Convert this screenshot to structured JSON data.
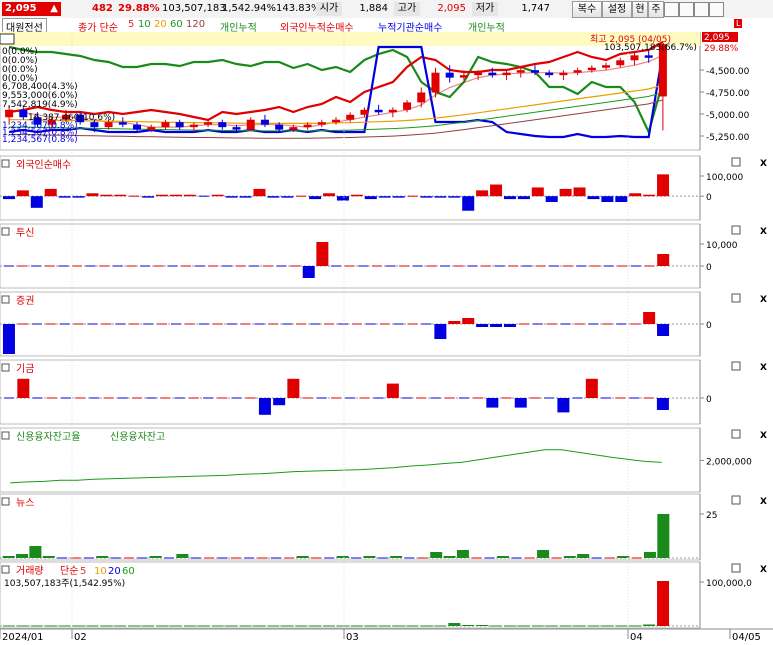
{
  "header": {
    "price": "2,095",
    "change": "482",
    "change_pct": "29.88%",
    "volume": "103,507,183",
    "volume_ratio": "1,542.94%",
    "turnover": "143.83%",
    "open_label": "시가",
    "open_value": "1,884",
    "high_label": "고가",
    "high_value": "2,095",
    "low_label": "저가",
    "low_value": "1,747",
    "buttons": [
      "복수",
      "설정",
      "현",
      "주"
    ]
  },
  "legend": {
    "stock_name": "대원전선",
    "close_label": "종가 단순",
    "ma_periods": [
      "5",
      "10",
      "20",
      "60",
      "120"
    ],
    "items": [
      "개인누적",
      "외국인누적순매수",
      "누적기관순매수",
      "개인누적"
    ]
  },
  "colors": {
    "up": "#e00000",
    "down": "#0000e0",
    "ma5": "#e03030",
    "ma10": "#1a9a1a",
    "ma20": "#e8a000",
    "ma60": "#1a9a1a",
    "ma120": "#904040",
    "individual": "#1a8a1a",
    "foreign": "#e00000",
    "institution": "#0000e0",
    "highlight": "#fffbc0"
  },
  "main_chart": {
    "max_label": "최고 2,095 (04/05)",
    "vol_callout": "103,507,183(66.7%)",
    "price_tag": "2,095",
    "pct_tag": "29.88%",
    "y_ticks": [
      "-4,500.00",
      "-4,750.00",
      "-5,000.00",
      "-5,250.00"
    ],
    "left_labels": [
      "0(0.0%)",
      "0(0.0%)",
      "0(0.0%)",
      "0(0.0%)",
      "6,708,400(4.3%)",
      "9,553,000(6.0%)",
      "7,542,819(4.9%)",
      "16,387,460(10.6%)",
      "1,234,567(0.8%)",
      "1,234,567(0.8%)",
      "1,234,567(0.8%)"
    ]
  },
  "panels": [
    {
      "title": "외국인순매수",
      "ticks": [
        "100,000",
        "0"
      ]
    },
    {
      "title": "투신",
      "ticks": [
        "10,000",
        "0"
      ]
    },
    {
      "title": "증권",
      "ticks": [
        "0"
      ]
    },
    {
      "title": "기금",
      "ticks": [
        "0"
      ]
    },
    {
      "title": "신용융자잔고율",
      "title2": "신용융자잔고",
      "ticks": [
        "2,000,000"
      ]
    },
    {
      "title": "뉴스",
      "ticks": [
        "25"
      ]
    },
    {
      "title": "거래량",
      "ma_label": "단순",
      "ma_periods": [
        "5",
        "10",
        "20",
        "60"
      ],
      "callout": "103,507,183주(1,542.95%)",
      "ticks": [
        "100,000,0"
      ]
    }
  ],
  "x_axis": {
    "labels": [
      "2024/01",
      "02",
      "03",
      "04",
      "04/05"
    ]
  },
  "chart_data": [
    {
      "type": "candlestick",
      "name": "main",
      "candles": [
        [
          1800,
          1850,
          1770,
          1830
        ],
        [
          1830,
          1840,
          1790,
          1800
        ],
        [
          1800,
          1820,
          1760,
          1770
        ],
        [
          1770,
          1800,
          1750,
          1790
        ],
        [
          1790,
          1830,
          1780,
          1810
        ],
        [
          1810,
          1820,
          1770,
          1780
        ],
        [
          1780,
          1790,
          1740,
          1760
        ],
        [
          1760,
          1790,
          1750,
          1780
        ],
        [
          1780,
          1800,
          1760,
          1770
        ],
        [
          1770,
          1780,
          1740,
          1750
        ],
        [
          1750,
          1770,
          1740,
          1760
        ],
        [
          1760,
          1790,
          1750,
          1780
        ],
        [
          1780,
          1790,
          1750,
          1760
        ],
        [
          1760,
          1780,
          1740,
          1770
        ],
        [
          1770,
          1790,
          1760,
          1780
        ],
        [
          1780,
          1790,
          1750,
          1760
        ],
        [
          1760,
          1770,
          1740,
          1750
        ],
        [
          1750,
          1800,
          1745,
          1790
        ],
        [
          1790,
          1810,
          1760,
          1770
        ],
        [
          1770,
          1780,
          1740,
          1750
        ],
        [
          1750,
          1770,
          1740,
          1760
        ],
        [
          1760,
          1780,
          1750,
          1770
        ],
        [
          1770,
          1790,
          1760,
          1780
        ],
        [
          1780,
          1800,
          1770,
          1790
        ],
        [
          1790,
          1820,
          1780,
          1810
        ],
        [
          1810,
          1840,
          1800,
          1830
        ],
        [
          1830,
          1850,
          1810,
          1820
        ],
        [
          1820,
          1840,
          1800,
          1830
        ],
        [
          1830,
          1870,
          1820,
          1860
        ],
        [
          1860,
          1920,
          1840,
          1900
        ],
        [
          1900,
          2000,
          1880,
          1980
        ],
        [
          1980,
          2010,
          1940,
          1960
        ],
        [
          1960,
          1990,
          1950,
          1970
        ],
        [
          1970,
          1990,
          1950,
          1980
        ],
        [
          1980,
          2000,
          1960,
          1970
        ],
        [
          1970,
          1990,
          1950,
          1980
        ],
        [
          1980,
          2000,
          1960,
          1990
        ],
        [
          1990,
          2010,
          1970,
          1980
        ],
        [
          1980,
          1990,
          1960,
          1970
        ],
        [
          1970,
          1990,
          1950,
          1980
        ],
        [
          1980,
          2000,
          1970,
          1990
        ],
        [
          1990,
          2010,
          1980,
          2000
        ],
        [
          2000,
          2020,
          1990,
          2010
        ],
        [
          2010,
          2040,
          2000,
          2030
        ],
        [
          2030,
          2060,
          2010,
          2050
        ],
        [
          2050,
          2070,
          2020,
          2040
        ],
        [
          1884,
          2095,
          1747,
          2095
        ]
      ],
      "ma5": [
        1830,
        1820,
        1810,
        1800,
        1800,
        1800,
        1790,
        1780,
        1780,
        1770,
        1760,
        1760,
        1760,
        1765,
        1770,
        1770,
        1765,
        1770,
        1770,
        1770,
        1765,
        1760,
        1770,
        1780,
        1790,
        1800,
        1810,
        1820,
        1830,
        1850,
        1890,
        1920,
        1940,
        1960,
        1970,
        1975,
        1978,
        1980,
        1980,
        1978,
        1980,
        1985,
        1990,
        2000,
        2010,
        2025,
        2050
      ],
      "ma20": [
        1790,
        1790,
        1789,
        1788,
        1787,
        1786,
        1785,
        1784,
        1783,
        1782,
        1781,
        1780,
        1779,
        1778,
        1778,
        1777,
        1776,
        1776,
        1775,
        1775,
        1775,
        1775,
        1776,
        1777,
        1778,
        1780,
        1782,
        1784,
        1787,
        1791,
        1796,
        1803,
        1810,
        1818,
        1826,
        1834,
        1842,
        1850,
        1858,
        1866,
        1874,
        1882,
        1890,
        1898,
        1906,
        1914,
        1930
      ],
      "individual": [
        0.95,
        0.92,
        0.9,
        0.9,
        0.88,
        0.86,
        0.82,
        0.8,
        0.75,
        0.75,
        0.78,
        0.78,
        0.76,
        0.8,
        0.8,
        0.82,
        0.78,
        0.76,
        0.8,
        0.8,
        0.74,
        0.78,
        0.72,
        0.75,
        0.7,
        0.82,
        0.88,
        0.92,
        0.85,
        0.6,
        0.5,
        0.45,
        0.6,
        0.85,
        0.8,
        0.78,
        0.75,
        0.7,
        0.55,
        0.55,
        0.48,
        0.6,
        0.55,
        0.55,
        0.4,
        0.1,
        0.6
      ],
      "foreign": [
        0.3,
        0.32,
        0.35,
        0.32,
        0.3,
        0.3,
        0.28,
        0.3,
        0.28,
        0.3,
        0.32,
        0.3,
        0.28,
        0.25,
        0.22,
        0.3,
        0.28,
        0.3,
        0.32,
        0.35,
        0.3,
        0.35,
        0.38,
        0.45,
        0.4,
        0.5,
        0.55,
        0.6,
        0.75,
        0.85,
        0.82,
        0.72,
        0.7,
        0.7,
        0.72,
        0.72,
        0.75,
        0.78,
        0.8,
        0.85,
        0.9,
        0.85,
        0.82,
        0.88,
        0.9,
        0.92,
        1.0
      ],
      "institution": [
        0.1,
        0.12,
        0.1,
        0.12,
        0.12,
        0.14,
        0.12,
        0.1,
        0.1,
        0.1,
        0.12,
        0.1,
        0.1,
        0.1,
        0.12,
        0.1,
        0.1,
        0.12,
        0.1,
        0.1,
        0.12,
        0.1,
        0.12,
        0.1,
        0.1,
        0.1,
        0.95,
        0.95,
        0.95,
        0.95,
        0.2,
        0.2,
        0.2,
        0.22,
        0.2,
        0.1,
        0.08,
        0.06,
        0.05,
        0.05,
        0.08,
        0.05,
        0.05,
        0.06,
        0.05,
        0.05,
        0.9
      ]
    },
    {
      "type": "bar",
      "name": "foreign_net",
      "values": [
        -2,
        4,
        -8,
        5,
        -1,
        -1,
        2,
        1,
        1,
        0,
        -1,
        1,
        1,
        1,
        0,
        1,
        -1,
        -1,
        5,
        -1,
        -1,
        0,
        -2,
        2,
        -3,
        1,
        -2,
        -1,
        -1,
        0,
        -1,
        -1,
        -1,
        -10,
        4,
        8,
        -2,
        -2,
        6,
        -4,
        5,
        6,
        -2,
        -4,
        -4,
        2,
        1,
        15
      ],
      "ylim": [
        -15,
        18
      ]
    },
    {
      "type": "bar",
      "name": "trust",
      "values": [
        0,
        0,
        0,
        0,
        0,
        0,
        0,
        0,
        0,
        0,
        0,
        0,
        0,
        0,
        0,
        0,
        0,
        0,
        0,
        0,
        0,
        0,
        -3,
        6,
        0,
        0,
        0,
        0,
        0,
        0,
        0,
        0,
        0,
        0,
        0,
        0,
        0,
        0,
        0,
        0,
        0,
        0,
        0,
        0,
        0,
        0,
        0,
        0,
        3
      ],
      "ylim": [
        -5,
        7
      ]
    },
    {
      "type": "bar",
      "name": "securities",
      "values": [
        -10,
        0,
        0,
        0,
        0,
        0,
        0,
        0,
        0,
        0,
        0,
        0,
        0,
        0,
        0,
        0,
        0,
        0,
        0,
        0,
        0,
        0,
        0,
        0,
        0,
        0,
        0,
        0,
        0,
        0,
        0,
        -5,
        1,
        2,
        -1,
        -1,
        -1,
        0,
        0,
        0,
        0,
        0,
        0,
        0,
        0,
        0,
        4,
        -4
      ],
      "ylim": [
        -10,
        6
      ]
    },
    {
      "type": "bar",
      "name": "fund",
      "values": [
        0,
        8,
        0,
        0,
        0,
        0,
        0,
        0,
        0,
        0,
        0,
        0,
        0,
        0,
        0,
        0,
        0,
        0,
        -7,
        -3,
        8,
        0,
        0,
        0,
        0,
        0,
        0,
        6,
        0,
        0,
        0,
        0,
        0,
        0,
        -4,
        0,
        -4,
        0,
        0,
        -6,
        0,
        8,
        0,
        0,
        0,
        0,
        -5
      ],
      "ylim": [
        -10,
        10
      ]
    },
    {
      "type": "line",
      "name": "credit_balance",
      "values": [
        1.0,
        1.2,
        1.3,
        1.5,
        1.5,
        1.7,
        1.8,
        1.9,
        2.0,
        2.1,
        2.2,
        2.3,
        2.4,
        2.5,
        2.7,
        2.8,
        3.0,
        3.2,
        3.3,
        3.4,
        3.5,
        3.6,
        3.8,
        4.0,
        4.3,
        4.5,
        4.8,
        5.0,
        5.5,
        6.0,
        6.5,
        7.0,
        7.5,
        7.5,
        7.0,
        6.5,
        6.0,
        5.6,
        5.2,
        5.0
      ],
      "ylim": [
        0,
        9
      ]
    },
    {
      "type": "bar",
      "name": "news",
      "values": [
        1,
        2,
        6,
        1,
        0,
        0,
        0,
        1,
        0,
        0,
        0,
        1,
        0,
        2,
        0,
        0,
        0,
        0,
        0,
        0,
        0,
        0,
        1,
        0,
        0,
        1,
        0,
        1,
        0,
        1,
        0,
        0,
        3,
        1,
        4,
        0,
        0,
        1,
        0,
        0,
        4,
        0,
        1,
        2,
        0,
        0,
        1,
        0,
        3,
        22
      ],
      "ylim": [
        0,
        25
      ]
    },
    {
      "type": "bar",
      "name": "volume",
      "values": [
        1,
        1,
        1,
        1,
        1,
        1,
        1,
        1,
        1,
        1,
        1,
        1,
        1,
        1,
        1,
        1,
        1,
        1,
        1,
        1,
        1,
        1,
        1,
        1,
        1,
        1,
        1,
        1,
        1,
        1,
        1,
        1,
        6,
        2,
        2,
        1,
        1,
        1,
        1,
        1,
        1,
        1,
        1,
        1,
        1,
        1,
        3,
        90
      ],
      "ylim": [
        0,
        100
      ]
    }
  ]
}
